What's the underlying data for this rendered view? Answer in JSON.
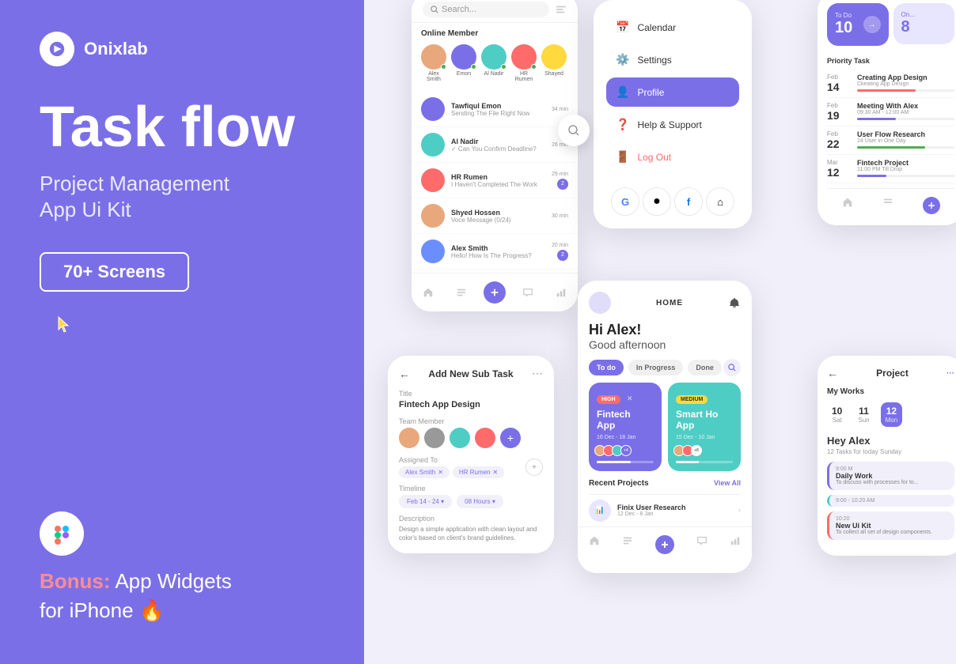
{
  "brand": {
    "name": "Onixlab",
    "tagline": "Task flow",
    "subtitle_line1": "Project Management",
    "subtitle_line2": "App Ui Kit",
    "screens_badge": "70+ Screens",
    "bonus_line1": "Bonus:",
    "bonus_line2": "App Widgets",
    "bonus_line3": "for iPhone 🔥"
  },
  "colors": {
    "primary": "#7B6FE8",
    "background_left": "#7B6FE8",
    "background_right": "#F0EFFA",
    "white": "#ffffff",
    "teal": "#4ECDC4",
    "red": "#FF6B6B",
    "yellow": "#FFD93D",
    "green": "#4CAF50"
  },
  "chat_screen": {
    "search_placeholder": "Search...",
    "online_member_title": "Online Member",
    "members": [
      {
        "name": "Alex Smith",
        "color": "#E8A87C"
      },
      {
        "name": "Emon",
        "color": "#7B6FE8"
      },
      {
        "name": "Al Nadir",
        "color": "#4ECDC4"
      },
      {
        "name": "HR Rumen",
        "color": "#FF6B6B"
      },
      {
        "name": "Shayed",
        "color": "#FFD93D"
      }
    ],
    "chats": [
      {
        "name": "Tawfiqul Emon",
        "msg": "Sending The File Right Now",
        "time": "34 min",
        "color": "#7B6FE8"
      },
      {
        "name": "Al Nadir",
        "msg": "✓ Can You Confirm Deadline?",
        "time": "26 min",
        "color": "#4ECDC4"
      },
      {
        "name": "HR Rumen",
        "msg": "I Haven't Completed The Work",
        "time": "29 min",
        "badge": "2",
        "color": "#FF6B6B"
      },
      {
        "name": "Shyed Hossen",
        "msg": "Voce Message (0/24)",
        "time": "30 min",
        "color": "#E8A87C"
      },
      {
        "name": "Alex Smith",
        "msg": "Hello! How Is The Progress?",
        "time": "20 min",
        "badge": "2",
        "color": "#6B8EFF"
      }
    ]
  },
  "menu_screen": {
    "items": [
      {
        "icon": "📅",
        "label": "Calendar",
        "active": false
      },
      {
        "icon": "⚙️",
        "label": "Settings",
        "active": false
      },
      {
        "icon": "👤",
        "label": "Profile",
        "active": true
      },
      {
        "icon": "❓",
        "label": "Help & Support",
        "active": false
      },
      {
        "icon": "🚪",
        "label": "Log Out",
        "active": false,
        "logout": true
      }
    ],
    "social": [
      "G",
      "●",
      "f",
      "⌂"
    ]
  },
  "home_screen": {
    "header_title": "HOME",
    "greeting": "Hi Alex!",
    "subgreeting": "Good afternoon",
    "tabs": [
      "To do",
      "In Progress",
      "Done"
    ],
    "cards": [
      {
        "badge": "HIGH",
        "title": "Fintech App",
        "dates": "16 Dec - 18 Jan",
        "color": "#7B6FE8"
      },
      {
        "badge": "MEDIUM",
        "title": "Smart Ho App",
        "dates": "15 Dec - 10 Jan",
        "color": "#4ECDC4"
      }
    ],
    "recent_title": "Recent Projects",
    "view_all": "View All",
    "projects": [
      {
        "name": "Finix User Research",
        "dates": "12 Dec - 8 Jan",
        "color": "#E8E5FF"
      }
    ]
  },
  "subtask_screen": {
    "title": "Add New Sub Task",
    "title_label": "Title",
    "title_value": "Fintech App Design",
    "team_label": "Team Member",
    "assigned_label": "Assigned To",
    "assignees": [
      "Alex Smith",
      "HR Rumen"
    ],
    "timeline_label": "Timeline",
    "timeline_value": "Feb 14 - 24",
    "hours_value": "08 Hours",
    "desc_label": "Description",
    "desc_text": "Design a simple application with clean layout and color's based on client's brand guidelines."
  },
  "calendar_screen": {
    "priority_label": "Priority Task",
    "stats": [
      {
        "label": "To Do",
        "num": "10"
      },
      {
        "label": "On...",
        "num": "8"
      }
    ],
    "tasks": [
      {
        "month": "Feb",
        "day": "14",
        "name": "Creating App Design",
        "sub": "Ckeating App Design",
        "progress": 60,
        "color": "#FF6B6B"
      },
      {
        "month": "Feb",
        "day": "19",
        "name": "Meeting With Alex",
        "sub": "09:30 AM - 12:00 AM",
        "progress": 40,
        "color": "#7B6FE8"
      },
      {
        "month": "Feb",
        "day": "22",
        "name": "User Flow Research",
        "sub": "24 User in One Day",
        "progress": 70,
        "color": "#4CAF50"
      },
      {
        "month": "Mar",
        "day": "12",
        "name": "Fintech Project",
        "sub": "11:00 PM Till Drop",
        "progress": 30,
        "color": "#7B6FE8"
      }
    ]
  },
  "project_phone": {
    "title": "Project",
    "my_works": "My Works",
    "dates": [
      {
        "num": "10",
        "day": "Sat"
      },
      {
        "num": "11",
        "day": "Sun"
      },
      {
        "num": "12",
        "day": "Mon",
        "active": true
      }
    ],
    "hey": "Hey Alex",
    "tasks_count": "12 Tasks for today Sunday",
    "schedules": [
      {
        "time": "9:00 M",
        "name": "Daily Work",
        "desc": "To discuss with processes for to..."
      },
      {
        "time": "9:00 - 10:20 AM",
        "name": "",
        "desc": ""
      },
      {
        "time": "10:20",
        "name": "New Ui Kit",
        "desc": "To collect all set of design components."
      }
    ]
  }
}
